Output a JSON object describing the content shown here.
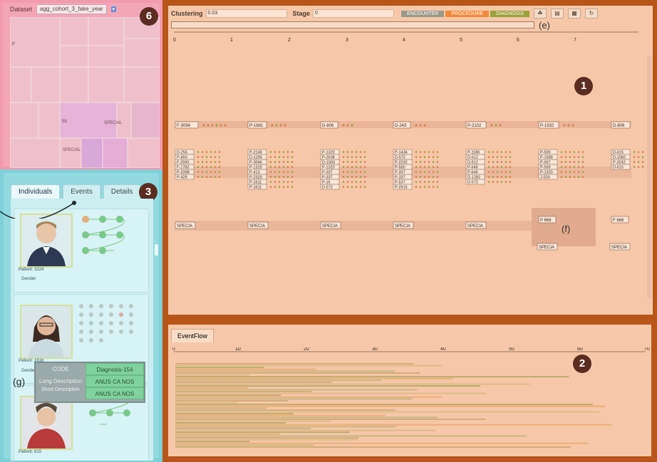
{
  "panel6": {
    "dataset_label": "Dataset",
    "dataset_value": "agg_cohort_3_fake_year",
    "badge": "6",
    "treemap_labels": [
      "SPECIAL",
      "SPECIAL",
      "F",
      "58"
    ]
  },
  "panel3": {
    "badge": "3",
    "tabs": [
      "Individuals",
      "Events",
      "Details"
    ],
    "patients": [
      {
        "id": "Patient: 3224",
        "gender": "Gender:"
      },
      {
        "id": "Patient: 1616",
        "gender": "Gender"
      },
      {
        "id": "Patient: 615"
      }
    ],
    "tooltip": {
      "label": "(g)",
      "rows": [
        {
          "key": "CODE",
          "value": "Diagnosis-154"
        },
        {
          "key": "Long Description",
          "value": "ANUS CA NOS"
        },
        {
          "key": "Short Description",
          "value": "ANUS CA NOS"
        }
      ]
    }
  },
  "panel1": {
    "badge": "1",
    "clustering_label": "Clustering",
    "clustering_value": "0.03",
    "stage_label": "Stage",
    "stage_value": "0",
    "type_buttons": [
      {
        "label": "ENCOUNTER",
        "color": "#9a9a8a"
      },
      {
        "label": "PROCEDURE",
        "color": "#f08a3a"
      },
      {
        "label": "DIAGNOSIS",
        "color": "#9aa23a"
      }
    ],
    "slider_label": "(e)",
    "axis_ticks": [
      "0",
      "1",
      "2",
      "3",
      "4",
      "5",
      "6",
      "7"
    ],
    "cluster_label": "(f)",
    "row1_labels": [
      "F-3094",
      "P-1681",
      "D-806",
      "D-243",
      "P-2102",
      "P-1532",
      "D-806"
    ],
    "row2_cols": [
      [
        "D-255",
        "P-650",
        "F-2590",
        "F-1783",
        "P-2398",
        "P-428"
      ],
      [
        "P-2148",
        "D-1206",
        "P-3046",
        "P-1320",
        "P-413",
        "P-2320",
        "P-1611",
        "P-1611"
      ],
      [
        "P-1320",
        "P-2638",
        "D-1583",
        "P-1320",
        "P-337",
        "P-337",
        "P-16",
        "D-572"
      ],
      [
        "P-1434",
        "D-572",
        "P-2232",
        "P-580",
        "P-337",
        "P-337",
        "P-537",
        "P-2915"
      ],
      [
        "P-1186",
        "D-512",
        "D-512",
        "P-648",
        "P-648",
        "D-1282",
        "D-572"
      ],
      [
        "P-599",
        "P-1589",
        "P-697",
        "P-599",
        "P-1320",
        "J-530"
      ],
      [
        "D-615",
        "D-1582",
        "P-3242",
        "D-615"
      ]
    ],
    "row3_labels": [
      "SPECIA",
      "SPECIA",
      "SPECIA",
      "SPECIA",
      "SPECIA",
      "P 666",
      "F 666",
      "SPECIA",
      "SPECIA"
    ]
  },
  "panel2": {
    "badge": "2",
    "tab_label": "EventFlow",
    "axis_ticks": [
      "0",
      "10",
      "20",
      "30",
      "40",
      "50",
      "60",
      "70"
    ]
  }
}
